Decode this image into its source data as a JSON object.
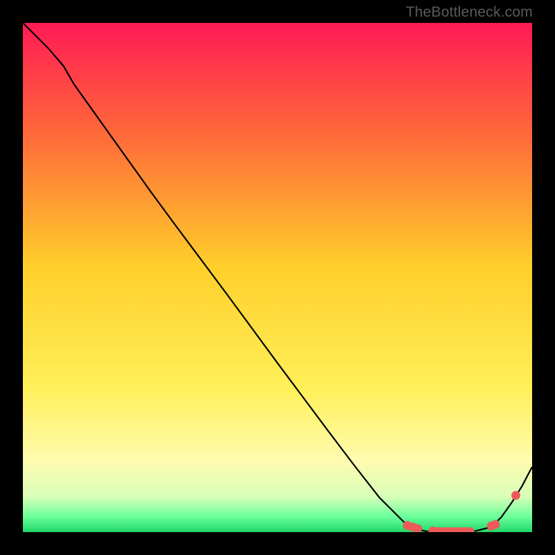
{
  "watermark": "TheBottleneck.com",
  "colors": {
    "top": "#ff1a55",
    "mid_upper": "#ff7a2a",
    "mid": "#ffd92a",
    "mid_lower": "#fff45a",
    "pale": "#ffffc8",
    "green": "#2ee67a",
    "stroke": "#000000",
    "marker": "#ee5a5a"
  },
  "chart_data": {
    "type": "line",
    "title": "",
    "xlabel": "",
    "ylabel": "",
    "x": [
      0.0,
      0.02,
      0.05,
      0.08,
      0.1,
      0.15,
      0.2,
      0.25,
      0.3,
      0.35,
      0.4,
      0.45,
      0.5,
      0.55,
      0.6,
      0.65,
      0.7,
      0.75,
      0.77,
      0.8,
      0.82,
      0.85,
      0.88,
      0.92,
      0.94,
      0.96,
      0.98,
      1.0
    ],
    "values": [
      1.0,
      0.98,
      0.95,
      0.915,
      0.88,
      0.81,
      0.74,
      0.67,
      0.602,
      0.535,
      0.468,
      0.4,
      0.332,
      0.265,
      0.198,
      0.132,
      0.068,
      0.018,
      0.006,
      0.0,
      0.0,
      0.0,
      0.0,
      0.01,
      0.03,
      0.058,
      0.09,
      0.128
    ],
    "markers_x": [
      0.755,
      0.765,
      0.775,
      0.805,
      0.815,
      0.822,
      0.83,
      0.838,
      0.846,
      0.854,
      0.862,
      0.87,
      0.878,
      0.92,
      0.928,
      0.968
    ],
    "markers_y": [
      0.013,
      0.01,
      0.007,
      0.002,
      0.001,
      0.001,
      0.001,
      0.001,
      0.001,
      0.001,
      0.001,
      0.001,
      0.001,
      0.012,
      0.015,
      0.072
    ],
    "xlim": [
      0,
      1
    ],
    "ylim": [
      0,
      1
    ]
  }
}
